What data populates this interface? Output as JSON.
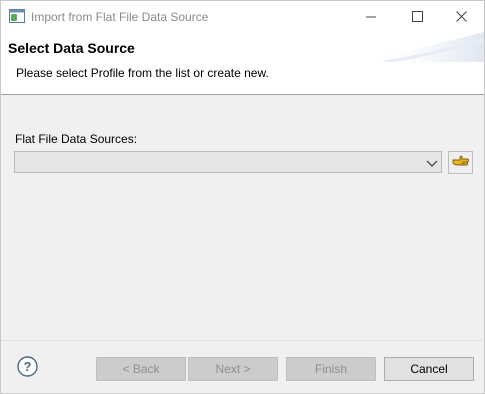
{
  "window": {
    "title": "Import from Flat File Data Source",
    "app_icon": "dialog-window-icon",
    "controls": {
      "minimize_icon": "minimize-icon",
      "maximize_icon": "maximize-icon",
      "close_icon": "close-icon"
    }
  },
  "header": {
    "title": "Select Data Source",
    "description": "Please select Profile from the list or create new."
  },
  "form": {
    "sources_label": "Flat File Data Sources:",
    "sources_value": "",
    "dropdown_icon": "chevron-down-icon",
    "profile_button_icon": "profile-hand-icon"
  },
  "footer": {
    "help_icon": "help-question-icon",
    "back_label": "< Back",
    "next_label": "Next >",
    "finish_label": "Finish",
    "cancel_label": "Cancel"
  },
  "colors": {
    "disabled_button_bg": "#cccccc",
    "disabled_text": "#8e8e8e",
    "dialog_bg": "#f0f0f0",
    "header_bg": "#ffffff",
    "accent_icon": "#d4a017"
  }
}
